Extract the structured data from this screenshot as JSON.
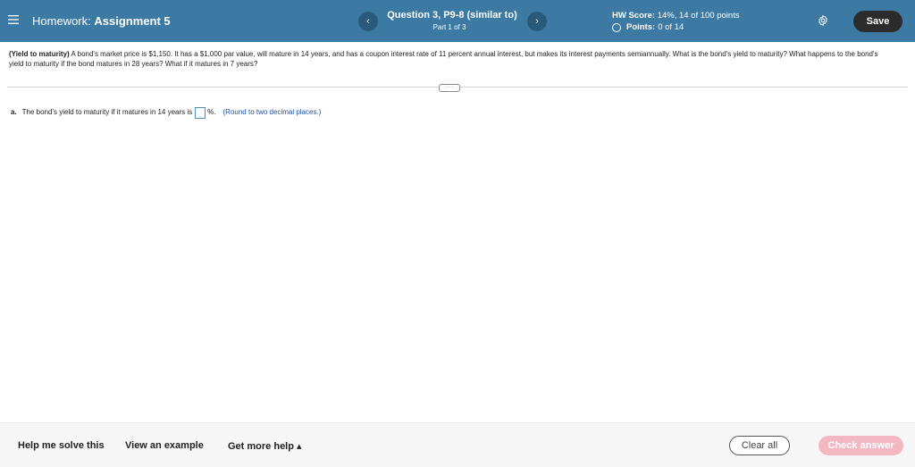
{
  "header": {
    "hw_label": "Homework:",
    "hw_name": "Assignment 5",
    "question_title": "Question 3, P9-8 (similar to)",
    "part": "Part 1 of 3",
    "hw_score_label": "HW Score:",
    "hw_score_value": "14%, 14 of 100 points",
    "points_label": "Points:",
    "points_value": "0 of 14",
    "prev_glyph": "‹",
    "next_glyph": "›",
    "save_label": "Save",
    "colors": {
      "bar": "#3d7aa3",
      "nav": "#2a5a7b",
      "save": "#2b2b2b"
    },
    "icons": [
      "menu-icon",
      "gear-icon",
      "circle-icon"
    ]
  },
  "question": {
    "title": "(Yield to maturity)",
    "body": "A bond's market price is $1,150. It has a $1,000 par value, will mature in 14 years, and has a coupon interest rate of 11 percent annual interest, but makes its interest payments semiannually. What is the bond's yield to maturity? What happens to the bond's yield to maturity if the bond matures in 28 years? What if it matures in 7 years?",
    "more_glyph": "· · ·"
  },
  "part_a": {
    "label": "a.",
    "text": "The bond's yield to maturity if it matures in 14 years is",
    "value": "",
    "unit": "%.",
    "hint": "(Round to two decimal places.)"
  },
  "footer": {
    "help_solve": "Help me solve this",
    "view_example": "View an example",
    "more_help": "Get more help ▴",
    "clear_all": "Clear all",
    "check_answer": "Check answer",
    "colors": {
      "check": "#f3b8c2"
    }
  }
}
